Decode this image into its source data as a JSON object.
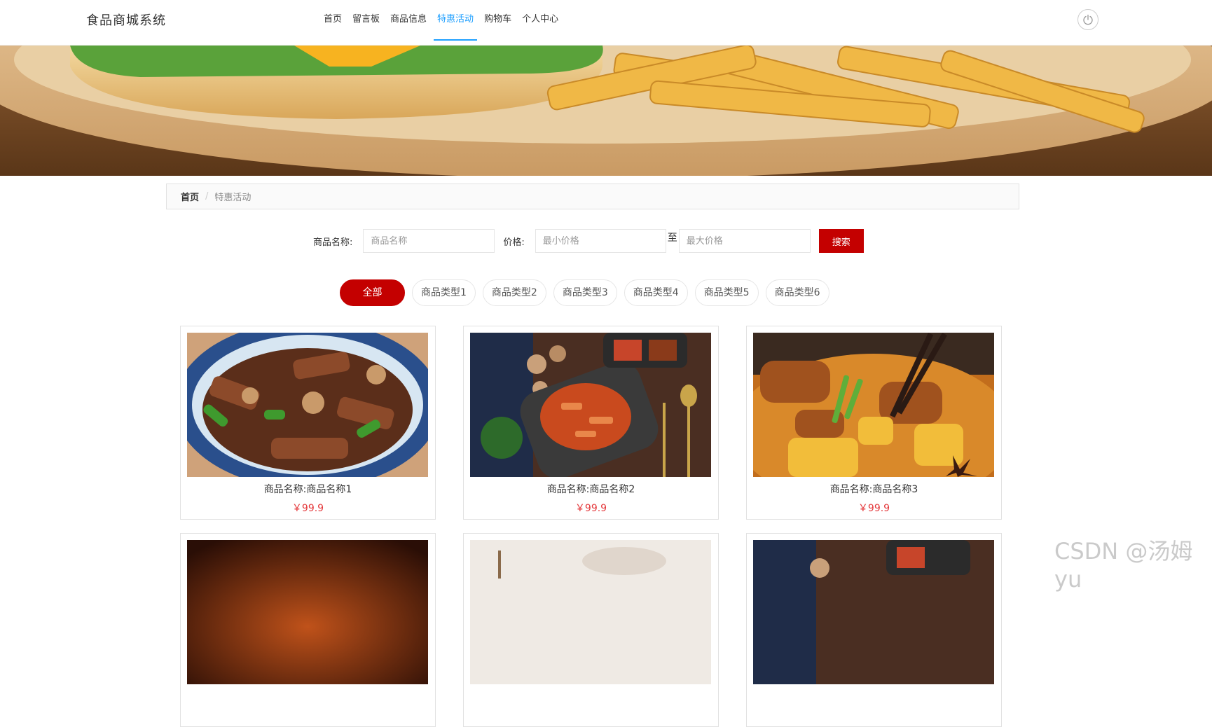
{
  "header": {
    "brand": "食品商城系统",
    "nav": [
      "首页",
      "留言板",
      "商品信息",
      "特惠活动",
      "购物车",
      "个人中心"
    ],
    "active_nav": "特惠活动"
  },
  "breadcrumb": {
    "home": "首页",
    "separator": "/",
    "current": "特惠活动"
  },
  "search": {
    "name_label": "商品名称:",
    "name_placeholder": "商品名称",
    "price_label": "价格:",
    "min_placeholder": "最小价格",
    "to": "至",
    "max_placeholder": "最大价格",
    "button": "搜索"
  },
  "categories": [
    "全部",
    "商品类型1",
    "商品类型2",
    "商品类型3",
    "商品类型4",
    "商品类型5",
    "商品类型6"
  ],
  "products": [
    {
      "name": "商品名称:商品名称1",
      "price": "￥99.9"
    },
    {
      "name": "商品名称:商品名称2",
      "price": "￥99.9"
    },
    {
      "name": "商品名称:商品名称3",
      "price": "￥99.9"
    },
    {
      "name": "",
      "price": ""
    },
    {
      "name": "",
      "price": ""
    },
    {
      "name": "",
      "price": ""
    }
  ],
  "watermark": "CSDN @汤姆yu",
  "colors": {
    "accent": "#c40000",
    "nav_active": "#1e9fff",
    "price": "#e4393c"
  }
}
